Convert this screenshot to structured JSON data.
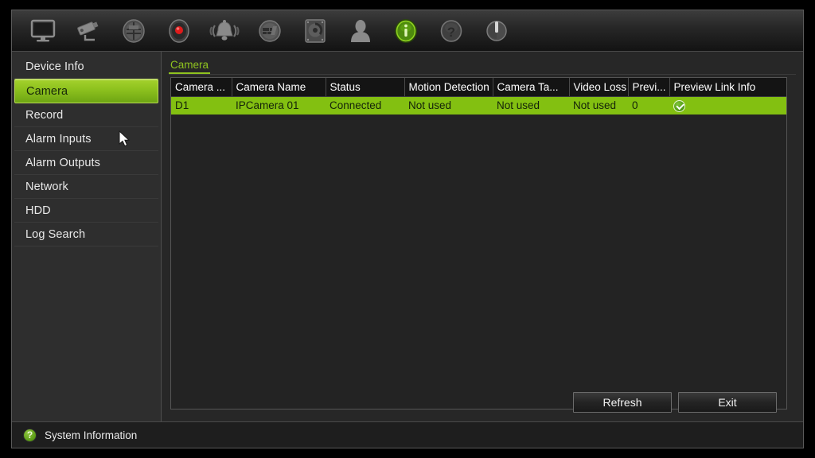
{
  "toolbar": {
    "items": [
      {
        "name": "monitor-icon",
        "label": "Live View"
      },
      {
        "name": "camera-icon",
        "label": "Camera"
      },
      {
        "name": "playback-icon",
        "label": "Playback"
      },
      {
        "name": "record-icon",
        "label": "Record"
      },
      {
        "name": "alarm-bell-icon",
        "label": "Alarm"
      },
      {
        "name": "network-icon",
        "label": "Network"
      },
      {
        "name": "hdd-icon",
        "label": "HDD"
      },
      {
        "name": "user-icon",
        "label": "User"
      },
      {
        "name": "info-icon",
        "label": "System Information"
      },
      {
        "name": "help-icon",
        "label": "Help"
      },
      {
        "name": "power-icon",
        "label": "Shutdown"
      }
    ],
    "active_index": 8,
    "active_color": "#6faf12"
  },
  "sidebar": {
    "items": [
      {
        "label": "Device Info",
        "selected": false
      },
      {
        "label": "Camera",
        "selected": true
      },
      {
        "label": "Record",
        "selected": false
      },
      {
        "label": "Alarm Inputs",
        "selected": false
      },
      {
        "label": "Alarm Outputs",
        "selected": false
      },
      {
        "label": "Network",
        "selected": false
      },
      {
        "label": "HDD",
        "selected": false
      },
      {
        "label": "Log Search",
        "selected": false
      }
    ],
    "selected_bg": "#8fc31f"
  },
  "content": {
    "tab_label": "Camera",
    "table": {
      "headers": [
        "Camera ...",
        "Camera Name",
        "Status",
        "Motion Detection",
        "Camera Ta...",
        "Video Loss",
        "Previ...",
        "Preview Link Info"
      ],
      "rows": [
        {
          "selected": true,
          "camera_no": "D1",
          "camera_name": "IPCamera 01",
          "status": "Connected",
          "motion_detection": "Not used",
          "camera_tamper": "Not used",
          "video_loss": "Not used",
          "preview": "0",
          "preview_link_info": "check-icon"
        }
      ],
      "row_selected_bg": "#83c011"
    }
  },
  "buttons": {
    "refresh_label": "Refresh",
    "exit_label": "Exit"
  },
  "statusbar": {
    "icon": "help-circle-icon",
    "icon_glyph": "?",
    "text": "System Information"
  }
}
